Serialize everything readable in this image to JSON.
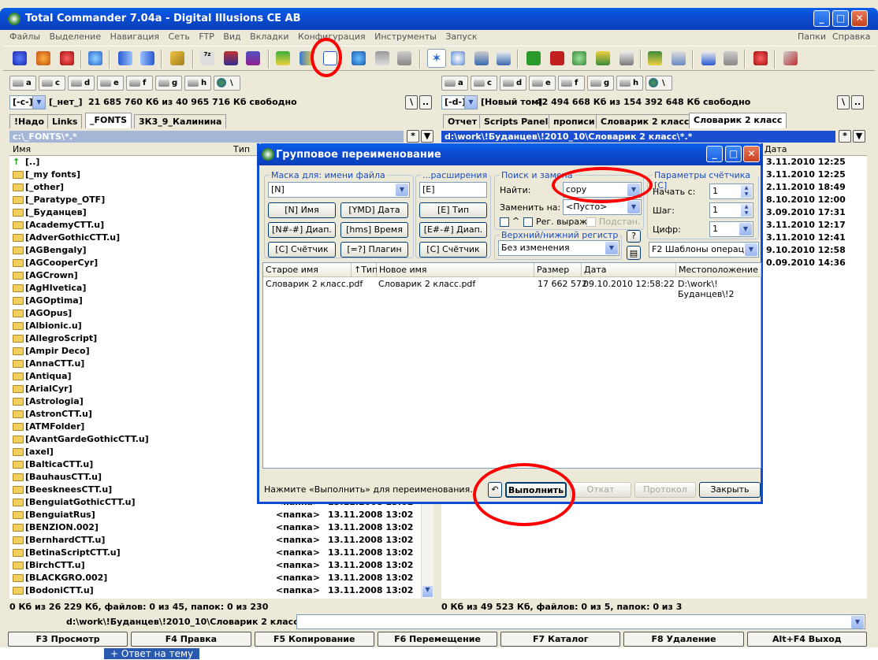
{
  "window": {
    "title": "Total Commander 7.04a - Digital Illusions CE AB"
  },
  "menu": {
    "items": [
      "Файлы",
      "Выделение",
      "Навигация",
      "Сеть",
      "FTP",
      "Вид",
      "Вкладки",
      "Конфигурация",
      "Инструменты",
      "Запуск"
    ],
    "right_items": [
      "Папки",
      "Справка"
    ]
  },
  "drives": {
    "left": [
      "a",
      "c",
      "d",
      "e",
      "f",
      "g",
      "h",
      "\\"
    ],
    "right": [
      "a",
      "c",
      "d",
      "e",
      "f",
      "g",
      "h",
      "\\"
    ]
  },
  "left": {
    "drive_combo": "[-c-]",
    "volume": "[_нет_]",
    "free": "21 685 760 Кб из 40 965 716 Кб свободно",
    "tabs": [
      "!Надо",
      "Links",
      "_FONTS",
      "3К3_9_Калинина"
    ],
    "active_tab": "_FONTS",
    "path": "c:\\_FONTS\\*.*",
    "col_name": "Имя",
    "col_type": "Тип",
    "up": "[..]",
    "folders": [
      "[_my fonts]",
      "[_other]",
      "[_Paratype_OTF]",
      "[_Буданцев]",
      "[AcademyCTT.u]",
      "[AdverGothicCTT.u]",
      "[AGBengaly]",
      "[AGCooperCyr]",
      "[AGCrown]",
      "[AgHIvetica]",
      "[AGOptima]",
      "[AGOpus]",
      "[Albionic.u]",
      "[AllegroScript]",
      "[Ampir Deco]",
      "[AnnaCTT.u]",
      "[Antiqua]",
      "[ArialCyr]",
      "[Astrologia]",
      "[AstronCTT.u]",
      "[ATMFolder]",
      "[AvantGardeGothicCTT.u]",
      "[axel]",
      "[BalticaCTT.u]",
      "[BauhausCTT.u]",
      "[BeeskneesCTT.u]",
      "[BenguiatGothicCTT.u]",
      "[BenguiatRus]",
      "[BENZION.002]",
      "[BernhardCTT.u]",
      "[BetinaScriptCTT.u]",
      "[BirchCTT.u]",
      "[BLACKGRO.002]",
      "[BodoniCTT.u]"
    ],
    "folder_type": "<папка>",
    "folder_date": "13.11.2008 13:02",
    "status": "0 Кб из 26 229 Кб, файлов: 0 из 45, папок: 0 из 230"
  },
  "right": {
    "drive_combo": "[-d-]",
    "volume": "[Новый том]",
    "free": "42 494 668 Кб из 154 392 648 Кб свободно",
    "tabs": [
      "Отчет",
      "Scripts Panel",
      "прописи",
      "Словарик 2 класс",
      "Словарик 2 класс"
    ],
    "path": "d:\\work\\!Буданцев\\!2010_10\\Словарик 2 класс\\*.*",
    "col_date": "Дата",
    "dates": [
      "3.11.2010 12:25",
      "3.11.2010 12:25",
      "2.11.2010 18:49",
      "8.10.2010 12:00",
      "3.09.2010 17:31",
      "3.11.2010 12:17",
      "3.11.2010 12:41",
      "9.10.2010 12:58",
      "0.09.2010 14:36"
    ],
    "status": "0 Кб из 49 523 Кб, файлов: 0 из 5, папок: 0 из 3"
  },
  "cmdline": {
    "path": "d:\\work\\!Буданцев\\!2010_10\\Словарик 2 класс>"
  },
  "fkeys": [
    "F3 Просмотр",
    "F4 Правка",
    "F5 Копирование",
    "F6 Перемещение",
    "F7 Каталог",
    "F8 Удаление",
    "Alt+F4 Выход"
  ],
  "bottom_link": "+ Ответ на тему",
  "dialog": {
    "title": "Групповое переименование",
    "mask_label": "Маска для: имени файла",
    "mask_value": "[N]",
    "ext_label": "...расширения",
    "ext_value": "[E]",
    "btn_name": "[N]      Имя",
    "btn_ymd": "[YMD] Дата",
    "btn_range": "[N#-#] Диап.",
    "btn_hms": "[hms]  Время",
    "btn_counter": "[C]      Счётчик",
    "btn_plugin": "[=?]    Плагин",
    "btn_ext_type": "[E]      Тип",
    "btn_ext_range": "[E#-#] Диап.",
    "btn_ext_counter": "[C]      Счётчик",
    "search_label": "Поиск и замена",
    "find_label": "Найти:",
    "find_value": "copy",
    "replace_label": "Заменить на:",
    "replace_value": "<Пусто>",
    "caret": "^",
    "regex_label": "Рег. выраж.",
    "subst_label": "Подстан.",
    "case_label": "Верхний/нижний регистр",
    "case_value": "Без изменения",
    "help": "?",
    "counter_label": "Параметры счётчика [C]",
    "start_label": "Начать с:",
    "start_value": "1",
    "step_label": "Шаг:",
    "step_value": "1",
    "digits_label": "Цифр:",
    "digits_value": "1",
    "templates": "F2 Шаблоны операции",
    "table": {
      "headers": [
        "Старое имя",
        "↑Тип",
        "Новое имя",
        "Размер",
        "Дата",
        "Местоположение"
      ],
      "rows": [
        {
          "old": "Словарик 2 класс.pdf",
          "new": "Словарик 2 класс.pdf",
          "size": "17 662 572",
          "date": "09.10.2010 12:58:22",
          "loc": "D:\\work\\!Буданцев\\!2"
        }
      ]
    },
    "hint": "Нажмите «Выполнить» для переименования.",
    "run": "Выполнить",
    "undo": "Откат",
    "log": "Протокол",
    "close": "Закрыть"
  },
  "colors": {
    "title_blue": "#0b4cd3",
    "annotation_red": "#ff0000",
    "folder": "#f2cf60"
  }
}
